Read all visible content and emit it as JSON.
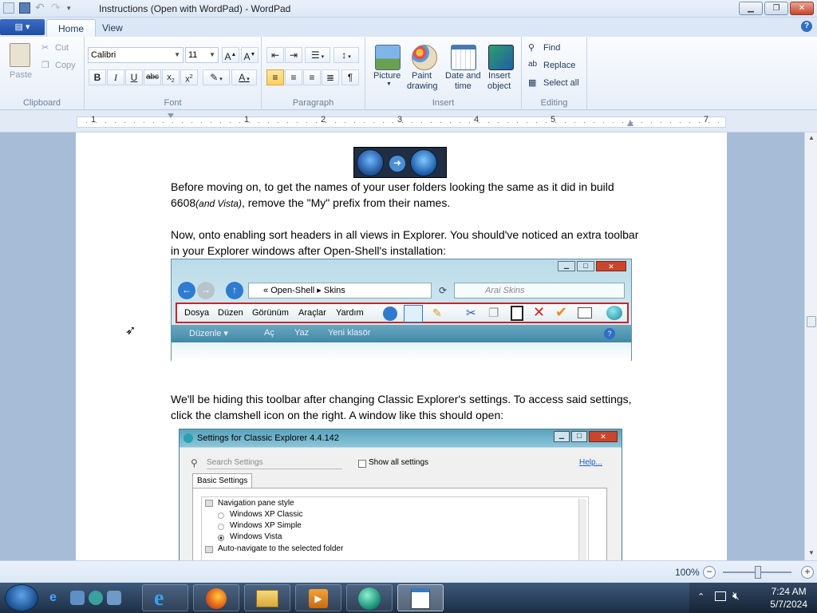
{
  "window": {
    "title": "Instructions (Open with WordPad) - WordPad"
  },
  "tabs": [
    {
      "label": "Home"
    },
    {
      "label": "View"
    }
  ],
  "ribbon": {
    "clipboard": {
      "paste": "Paste",
      "cut": "Cut",
      "copy": "Copy",
      "label": "Clipboard"
    },
    "font": {
      "family": "Calibri",
      "size": "11",
      "label": "Font"
    },
    "paragraph": {
      "label": "Paragraph"
    },
    "insert": {
      "picture": "Picture",
      "paint_line1": "Paint",
      "paint_line2": "drawing",
      "datetime_line1": "Date and",
      "datetime_line2": "time",
      "object_line1": "Insert",
      "object_line2": "object",
      "label": "Insert"
    },
    "editing": {
      "find": "Find",
      "replace": "Replace",
      "select_all": "Select all",
      "label": "Editing"
    }
  },
  "ruler": {
    "ticks": [
      "1",
      "1",
      "2",
      "3",
      "4",
      "5",
      "7"
    ]
  },
  "document": {
    "para1_part1": "Before moving on, to get the names of your user folders looking the same as it did in build 6608",
    "para1_italic": "(and Vista)",
    "para1_part2": ", remove the \"My\" prefix from their names.",
    "para2": "Now, onto enabling sort headers in all views in Explorer. You should've noticed an extra toolbar in your Explorer windows after Open-Shell's installation:",
    "para3": "We'll be hiding this toolbar after changing Classic Explorer's settings. To access said settings, click the clamshell icon on the right. A window like this should open:",
    "explorer_shot": {
      "path1": "Open-Shell",
      "path2": "Skins",
      "search_placeholder": "Arai Skins",
      "menu": [
        "Dosya",
        "Düzen",
        "Görünüm",
        "Araçlar",
        "Yardım"
      ],
      "cmd": [
        "Düzenle ▾",
        "Aç",
        "Yaz",
        "Yeni klasör"
      ]
    },
    "settings_shot": {
      "title": "Settings for Classic Explorer 4.4.142",
      "search_placeholder": "Search Settings",
      "show_all": "Show all settings",
      "help": "Help...",
      "tab": "Basic Settings",
      "items": [
        "Navigation pane style",
        "Windows XP Classic",
        "Windows XP Simple",
        "Windows Vista",
        "Auto-navigate to the selected folder"
      ]
    }
  },
  "status": {
    "zoom": "100%"
  },
  "taskbar": {
    "time": "7:24 AM",
    "date": "5/7/2024"
  },
  "colors": {
    "ribbon_bg": "#e6eef8",
    "canvas_bg": "#a7bcd6",
    "accent": "#2f6ec5"
  }
}
